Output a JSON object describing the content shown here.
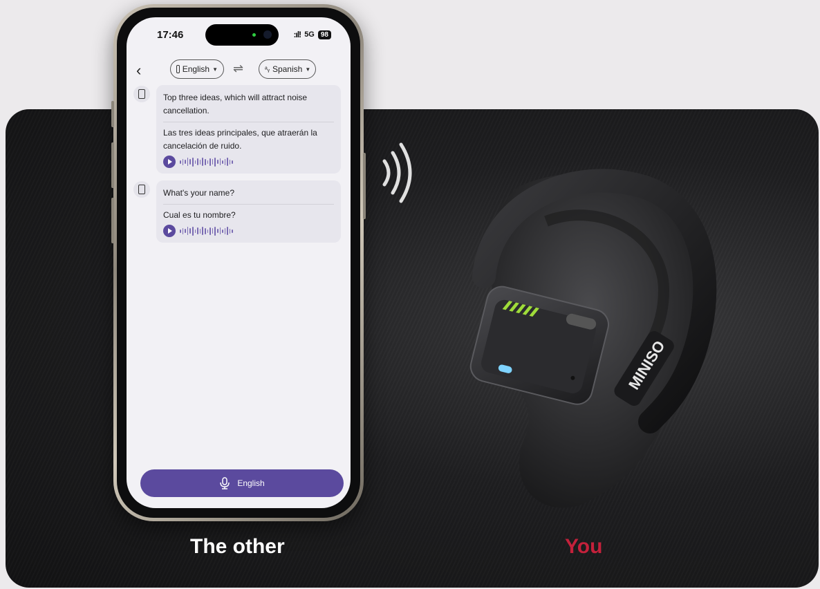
{
  "captions": {
    "left": "The other",
    "right": "You"
  },
  "status_bar": {
    "time": "17:46",
    "signal": ":ıl!",
    "network": "5G",
    "battery": "98"
  },
  "nav": {
    "back_icon": "chevron-left-icon",
    "source_language": "English",
    "target_language": "Spanish",
    "swap_icon": "swap-arrows-icon"
  },
  "messages": [
    {
      "original": "Top three ideas, which will attract noise cancellation.",
      "translation": "Las tres ideas principales, que atraerán la cancelación de ruido."
    },
    {
      "original": "What's your name?",
      "translation": "Cual es tu nombre?"
    }
  ],
  "mic_button": {
    "label": "English",
    "icon": "microphone-icon"
  },
  "earbud": {
    "brand": "MINISO"
  },
  "colors": {
    "accent": "#5b4a9e",
    "you_label": "#c4213b",
    "led": "#9fdc3a"
  }
}
